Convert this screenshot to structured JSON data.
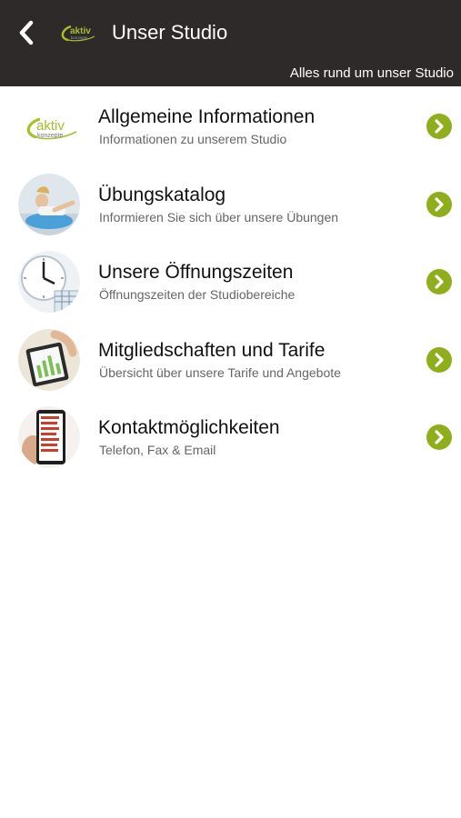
{
  "header": {
    "title": "Unser Studio",
    "subtitle": "Alles rund um unser Studio",
    "logo_text": "aktiv konzepte",
    "back_icon": "chevron-left-icon"
  },
  "colors": {
    "header_bg": "#2e2a29",
    "accent": "#8fae1b",
    "title_text": "#111111",
    "subtitle_text": "#666666"
  },
  "menu": {
    "items": [
      {
        "title": "Allgemeine Informationen",
        "subtitle": "Informationen zu unserem Studio",
        "image": "aktiv-konzepte-logo",
        "chevron": "chevron-right-circle-icon"
      },
      {
        "title": "Übungskatalog",
        "subtitle": "Informieren Sie sich über unsere Übungen",
        "image": "woman-exercising-photo",
        "chevron": "chevron-right-circle-icon"
      },
      {
        "title": "Unsere Öffnungszeiten",
        "subtitle": "Öffnungszeiten der Studiobereiche",
        "image": "clock-and-calendar-photo",
        "chevron": "chevron-right-circle-icon"
      },
      {
        "title": "Mitgliedschaften und Tarife",
        "subtitle": "Übersicht über unsere Tarife und Angebote",
        "image": "tablet-pricing-photo",
        "chevron": "chevron-right-circle-icon"
      },
      {
        "title": "Kontaktmöglichkeiten",
        "subtitle": "Telefon, Fax & Email",
        "image": "contact-list-phone-photo",
        "chevron": "chevron-right-circle-icon"
      }
    ]
  }
}
